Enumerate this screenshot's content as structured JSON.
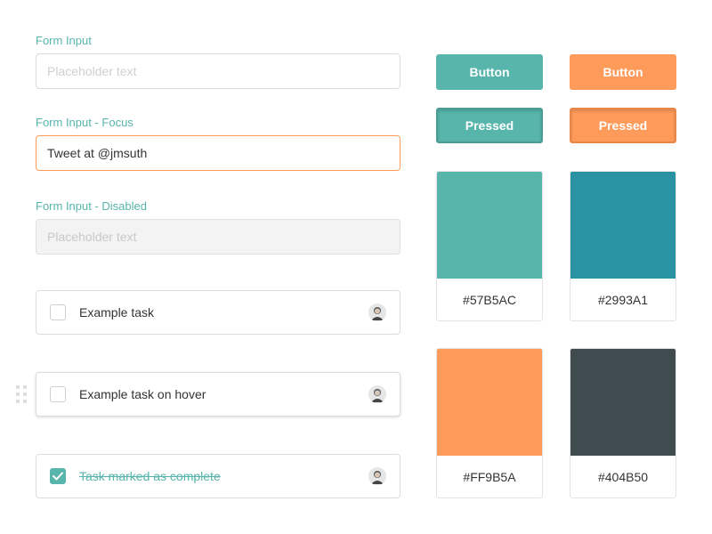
{
  "form": {
    "input_default": {
      "label": "Form Input",
      "placeholder": "Placeholder text",
      "value": ""
    },
    "input_focus": {
      "label": "Form Input - Focus",
      "value": "Tweet at @jmsuth"
    },
    "input_disabled": {
      "label": "Form Input - Disabled",
      "placeholder": "Placeholder text"
    }
  },
  "tasks": [
    {
      "text": "Example task",
      "checked": false
    },
    {
      "text": "Example task on hover",
      "checked": false
    },
    {
      "text": "Task marked as complete",
      "checked": true
    }
  ],
  "buttons": {
    "teal": {
      "label": "Button",
      "pressed_label": "Pressed",
      "color": "#57B5AC"
    },
    "orange": {
      "label": "Button",
      "pressed_label": "Pressed",
      "color": "#FF9B5A"
    }
  },
  "swatches": [
    {
      "hex": "#57B5AC"
    },
    {
      "hex": "#2993A1"
    },
    {
      "hex": "#FF9B5A"
    },
    {
      "hex": "#404B50"
    }
  ],
  "icons": {
    "checkmark": "checkmark-icon",
    "avatar": "user-avatar",
    "drag": "drag-handle-icon"
  }
}
